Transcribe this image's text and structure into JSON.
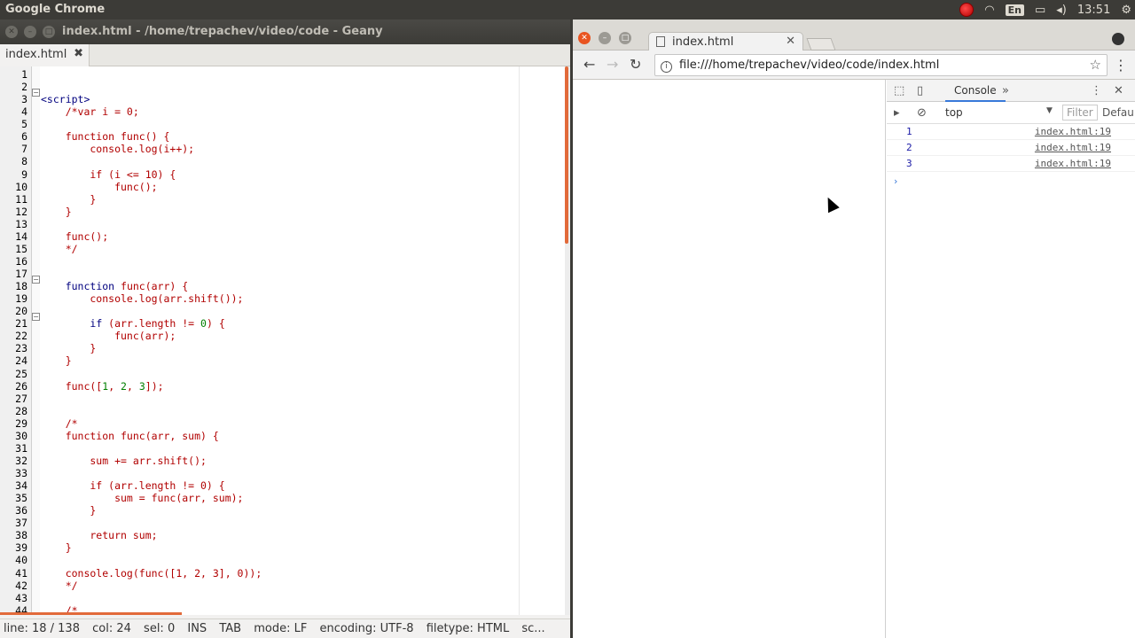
{
  "top_panel": {
    "app_name": "Google Chrome",
    "keyboard_layout": "En",
    "time": "13:51"
  },
  "geany": {
    "title": "index.html - /home/trepachev/video/code - Geany",
    "tab_label": "index.html",
    "line_numbers": [
      "1",
      "2",
      "3",
      "4",
      "5",
      "6",
      "7",
      "8",
      "9",
      "10",
      "11",
      "12",
      "13",
      "14",
      "15",
      "16",
      "17",
      "18",
      "19",
      "20",
      "21",
      "22",
      "23",
      "24",
      "25",
      "26",
      "27",
      "28",
      "29",
      "30",
      "31",
      "32",
      "33",
      "34",
      "35",
      "36",
      "37",
      "38",
      "39",
      "40",
      "41",
      "42",
      "43",
      "44"
    ],
    "code_lines": [
      "",
      "",
      "<script>",
      "    /*var i = 0;",
      "",
      "    function func() {",
      "        console.log(i++);",
      "",
      "        if (i <= 10) {",
      "            func();",
      "        }",
      "    }",
      "",
      "    func();",
      "    */",
      "",
      "",
      "    function func(arr) {",
      "        console.log(arr.shift());",
      "",
      "        if (arr.length != 0) {",
      "            func(arr);",
      "        }",
      "    }",
      "",
      "    func([1, 2, 3]);",
      "",
      "",
      "    /*",
      "    function func(arr, sum) {",
      "",
      "        sum += arr.shift();",
      "",
      "        if (arr.length != 0) {",
      "            sum = func(arr, sum);",
      "        }",
      "",
      "        return sum;",
      "    }",
      "",
      "    console.log(func([1, 2, 3], 0));",
      "    */",
      "",
      "    /*"
    ],
    "status": {
      "line": "line: 18 / 138",
      "col": "col: 24",
      "sel": "sel: 0",
      "ins": "INS",
      "tab": "TAB",
      "mode": "mode: LF",
      "encoding": "encoding: UTF-8",
      "filetype": "filetype: HTML",
      "scope": "sc..."
    }
  },
  "chrome": {
    "tab_title": "index.html",
    "url": "file:///home/trepachev/video/code/index.html",
    "devtools": {
      "active_tab": "Console",
      "context": "top",
      "filter_placeholder": "Filter",
      "level": "Defau",
      "logs": [
        {
          "value": "1",
          "source": "index.html:19"
        },
        {
          "value": "2",
          "source": "index.html:19"
        },
        {
          "value": "3",
          "source": "index.html:19"
        }
      ],
      "prompt": "›"
    }
  },
  "colors": {
    "keyword": "#00007f",
    "comment": "#b10000",
    "number": "#007f00",
    "scroll_accent": "#e26a3a",
    "panel": "#3c3b37"
  }
}
